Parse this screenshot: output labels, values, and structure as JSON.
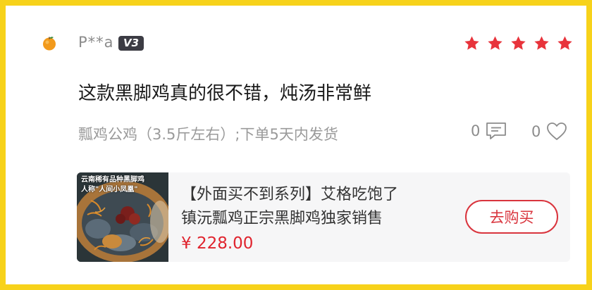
{
  "review": {
    "user": {
      "name": "P**a",
      "level": "V3",
      "avatar_icon": "orange-fruit-icon"
    },
    "rating": {
      "value": 5,
      "max": 5,
      "color": "#e8333b"
    },
    "text": "这款黑脚鸡真的很不错，炖汤非常鲜",
    "spec": "瓢鸡公鸡（3.5斤左右）;下单5天内发货",
    "comment_count": "0",
    "like_count": "0"
  },
  "product": {
    "image_caption": "云南稀有品种黑脚鸡\n人称\"人间小凤凰\"",
    "title_line1": "【外面买不到系列】艾格吃饱了",
    "title_line2": "镇沅瓢鸡正宗黑脚鸡独家销售",
    "price": "¥ 228.00",
    "buy_label": "去购买",
    "price_color": "#e0242e"
  },
  "frame_color": "#f7d21a"
}
